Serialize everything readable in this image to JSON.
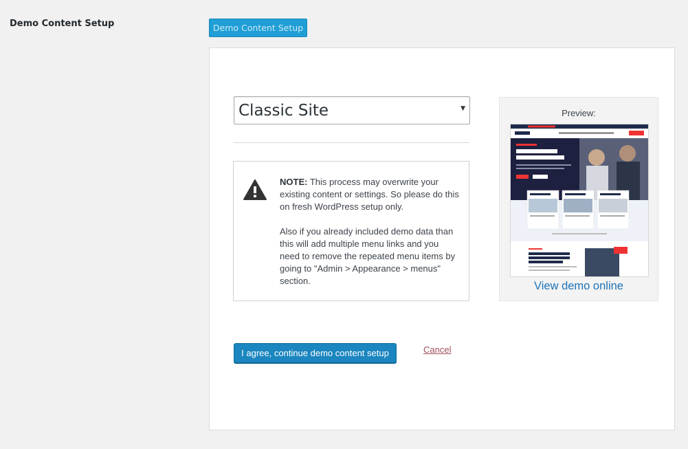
{
  "setting": {
    "label": "Demo Content Setup",
    "button_label": "Demo Content Setup"
  },
  "demo_select": {
    "selected": "Classic Site"
  },
  "note": {
    "title": "NOTE:",
    "text": " This process may overwrite your existing content or settings. So please do this on fresh WordPress setup only.",
    "text2": "Also if you already included demo data than this will add multiple menu links and you need to remove the repeated menu items by going to \"Admin > Appearance > menus\" section."
  },
  "preview": {
    "label": "Preview:",
    "view_link": "View demo online"
  },
  "actions": {
    "agree_label": "I agree, continue demo content setup",
    "cancel_label": "Cancel"
  },
  "icons": {
    "warning": "warning-triangle-icon"
  },
  "colors": {
    "primary_button": "#1b86bf",
    "top_button": "#1f9fd6",
    "link": "#1d73b7",
    "cancel_link": "#a0505a"
  }
}
